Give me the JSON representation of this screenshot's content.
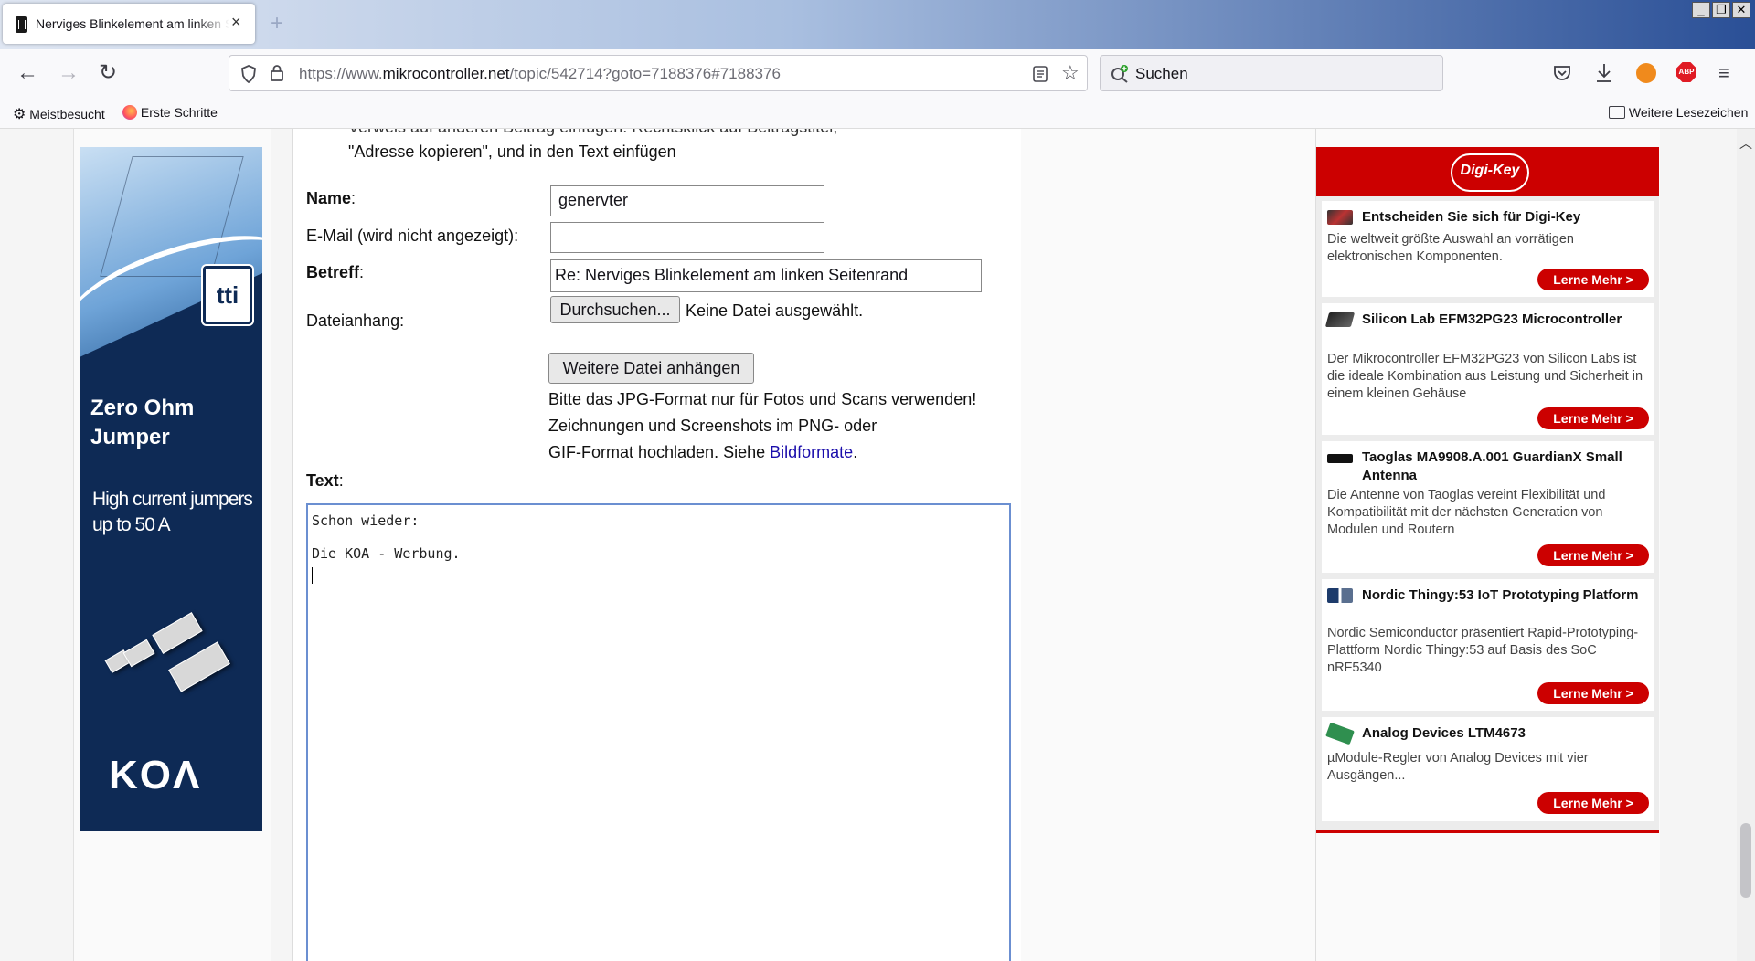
{
  "browser": {
    "tab_title": "Nerviges Blinkelement am linken Seitenrand",
    "tab_close": "×",
    "new_tab": "+",
    "win_min": "_",
    "win_max": "❐",
    "win_close": "✕",
    "url_prefix": "https://www.",
    "url_domain": "mikrocontroller.net",
    "url_path": "/topic/542714?goto=7188376#7188376",
    "search_placeholder": "Suchen",
    "bookmarks": [
      "Meistbesucht",
      "Erste Schritte"
    ],
    "other_bookmarks": "Weitere Lesezeichen"
  },
  "left_ad": {
    "title": "Zero Ohm Jumper",
    "subtitle": "High current jumpers up to 50 A",
    "badge": "tti",
    "logo": "KOΛ"
  },
  "form": {
    "hint_top": "Verweis auf anderen Beitrag einfügen: Rechtsklick auf Beitragstitel,",
    "hint_line2": "\"Adresse kopieren\", und in den Text einfügen",
    "name_label": "Name",
    "name_value": "genervter",
    "email_label": "E-Mail (wird nicht angezeigt):",
    "email_value": "",
    "subject_label": "Betreff",
    "subject_value": "Re: Nerviges Blinkelement am linken Seitenrand",
    "attach_label": "Dateianhang:",
    "browse_button": "Durchsuchen...",
    "no_file": "Keine Datei ausgewählt.",
    "add_file_button": "Weitere Datei anhängen",
    "note_line1": "Bitte das JPG-Format nur für Fotos und Scans verwenden!",
    "note_line2": "Zeichnungen und Screenshots im PNG- oder",
    "note_line3": "GIF-Format hochladen. Siehe",
    "note_link": "Bildformate",
    "note_end": ".",
    "text_label": "Text",
    "text_line1": "Schon wieder:",
    "text_line2": "Die KOA - Werbung."
  },
  "right_ad": {
    "logo": "Digi-Key",
    "cta": "Lerne Mehr >",
    "items": [
      {
        "title": "Entscheiden Sie sich für Digi-Key",
        "desc": "Die weltweit größte Auswahl an vorrätigen elektronischen Komponenten."
      },
      {
        "title": "Silicon Lab EFM32PG23 Microcontroller",
        "desc": "Der Mikrocontroller EFM32PG23 von Silicon Labs ist die ideale Kombination aus Leistung und Sicherheit in einem kleinen Gehäuse"
      },
      {
        "title": "Taoglas MA9908.A.001 GuardianX Small Antenna",
        "desc": "Die Antenne von Taoglas vereint Flexibilität und Kompatibilität mit der nächsten Generation von Modulen und Routern"
      },
      {
        "title": "Nordic Thingy:53 IoT Prototyping Platform",
        "desc": "Nordic Semiconductor präsentiert Rapid-Prototyping-Plattform Nordic Thingy:53 auf Basis des SoC nRF5340"
      },
      {
        "title": "Analog Devices LTM4673",
        "desc": "µModule-Regler von Analog Devices mit vier Ausgängen..."
      }
    ]
  }
}
